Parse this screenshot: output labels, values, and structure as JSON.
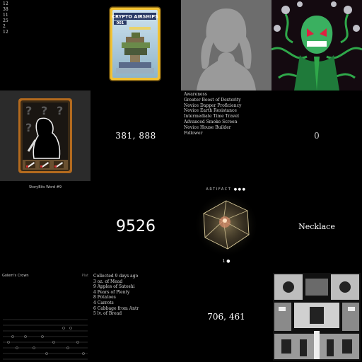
{
  "numbers_list": [
    "12",
    "38",
    "11",
    "25",
    "2",
    "12"
  ],
  "airship": {
    "title": "CRYPTO AIRSHIPS",
    "number": "001"
  },
  "storybits": {
    "caption": "StoryBits Word #9"
  },
  "coords_top": "381, 888",
  "skills": [
    "Awareness",
    "Greater Boost of Dexterity",
    "Novice Dapper Proficiency",
    "Novice Earth Resistance",
    "Intermediate Time Travel",
    "Advanced Smoke Screen",
    "Novice House Builder",
    "Follower"
  ],
  "zero_value": "0",
  "big_number": "9526",
  "artifact": {
    "label": "ARTIFACT",
    "count_label": "1"
  },
  "necklace": "Necklace",
  "golem": {
    "title": "Golem's Crown",
    "status": "Plat"
  },
  "inventory": [
    "Collected 9 days ago",
    "3 oz. of Mead",
    "9 Apples of Satoshi",
    "4 Pears of Plenty",
    "8 Potatoes",
    "4 Carrots",
    "6 Cabbage from Antr",
    "5 lv. of Bread"
  ],
  "coords_bottom": "706, 461"
}
